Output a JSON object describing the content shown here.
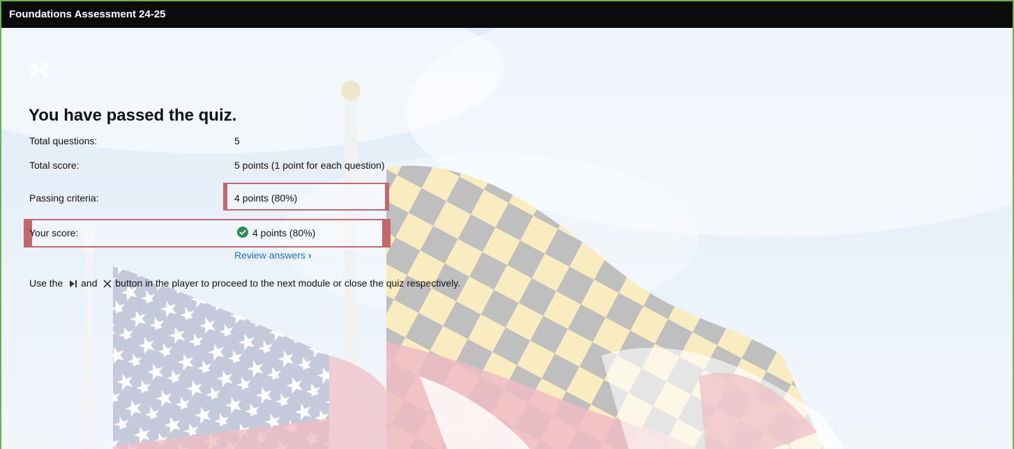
{
  "window": {
    "title": "Foundations Assessment 24-25"
  },
  "result": {
    "heading": "You have passed the quiz.",
    "rows": {
      "total_questions": {
        "label": "Total questions:",
        "value": "5"
      },
      "total_score": {
        "label": "Total score:",
        "value": "5 points (1 point for each question)"
      },
      "passing_criteria": {
        "label": "Passing criteria:",
        "value": "4 points (80%)"
      },
      "your_score": {
        "label": "Your score:",
        "value": "4 points (80%)",
        "status": "passed"
      }
    },
    "review_link": "Review answers"
  },
  "instructions": {
    "part1": "Use the",
    "part2": "and",
    "part3": "button in the player to proceed to the next module or close the quiz respectively.",
    "next_icon": "skip-next-icon",
    "close_icon": "close-icon"
  },
  "colors": {
    "title_bar": "#0b0b0b",
    "frame_border": "#6ab04c",
    "highlight_border": "#c4666e",
    "link": "#1a73c8",
    "success": "#2e8b57"
  }
}
